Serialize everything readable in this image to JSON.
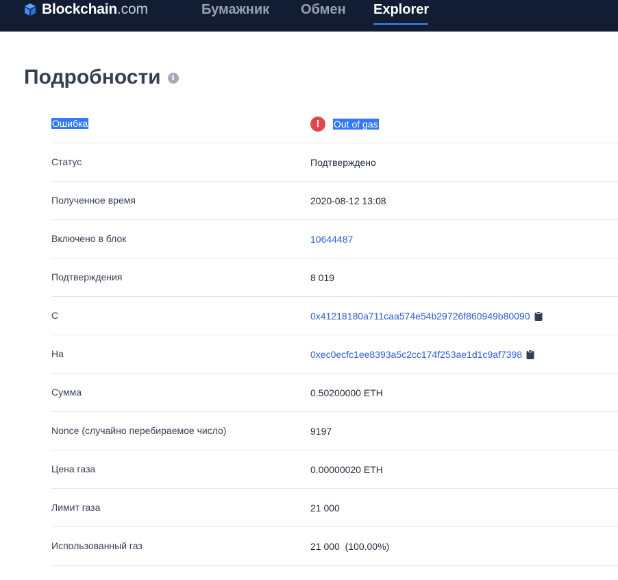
{
  "header": {
    "brand": "Blockchain",
    "brand_suffix": ".com",
    "nav": [
      {
        "label": "Бумажник",
        "active": false
      },
      {
        "label": "Обмен",
        "active": false
      },
      {
        "label": "Explorer",
        "active": true
      }
    ]
  },
  "colors": {
    "header_bg": "#121d33",
    "accent": "#3d89f5",
    "link": "#2a5fcf",
    "success": "#1f8a4c",
    "error": "#e0474c",
    "selection": "#3478f6"
  },
  "details": {
    "title": "Подробности",
    "info_icon": "info-icon",
    "rows": [
      {
        "label": "Ошибка",
        "value": "Out of gas"
      },
      {
        "label": "Статус",
        "value": "Подтверждено"
      },
      {
        "label": "Полученное время",
        "value": "2020-08-12 13:08"
      },
      {
        "label": "Включено в блок",
        "value": "10644487"
      },
      {
        "label": "Подтверждения",
        "value": "8 019"
      },
      {
        "label": "С",
        "value": "0x41218180a711caa574e54b29726f860949b80090"
      },
      {
        "label": "На",
        "value": "0xec0ecfc1ee8393a5c2cc174f253ae1d1c9af7398"
      },
      {
        "label": "Сумма",
        "value": "0.50200000 ETH"
      },
      {
        "label": "Nonce (случайно перебираемое число)",
        "value": "9197"
      },
      {
        "label": "Цена газа",
        "value": "0.00000020 ETH"
      },
      {
        "label": "Лимит газа",
        "value": "21 000"
      },
      {
        "label": "Использованный газ",
        "value": "21 000  (100.00%)"
      }
    ]
  }
}
